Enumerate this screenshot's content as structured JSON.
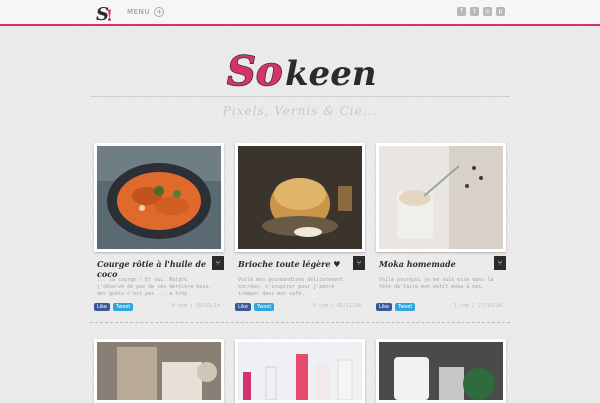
{
  "topbar": {
    "menu_label": "MENU",
    "menu_icon": "plus-circle-icon",
    "social_icons": [
      "facebook-icon",
      "twitter-icon",
      "instagram-icon",
      "pinterest-icon"
    ]
  },
  "brand": {
    "logo_text_left": "So",
    "logo_text_right": "keen!",
    "tagline": "Pixels, Vernis & Cie...",
    "accent": "#d6336c"
  },
  "posts": [
    {
      "title": "Courge rôtie à l'huile de coco",
      "excerpt": "... la courge ! Et oui. Malgré j'observé de pas de ces dernière mois, des goûts c'est pas ... a trop c'changé, je suis",
      "like_label": "Like",
      "tweet_label": "Tweet",
      "meta": "0 com | 10/11/14"
    },
    {
      "title": "Brioche toute légère ♥",
      "excerpt": "Voilà mes gourmandises délicatement sucrées, s'inspirer pour j'adore tremper dans mon café.",
      "like_label": "Like",
      "tweet_label": "Tweet",
      "meta": "0 com | 05/11/14"
    },
    {
      "title": "Moka homemade",
      "excerpt": "Voilà pourquoi je me suis mise dans la tête de faire mon petit moka à moi.",
      "like_label": "Like",
      "tweet_label": "Tweet",
      "meta": "1 com | 27/10/14"
    }
  ]
}
